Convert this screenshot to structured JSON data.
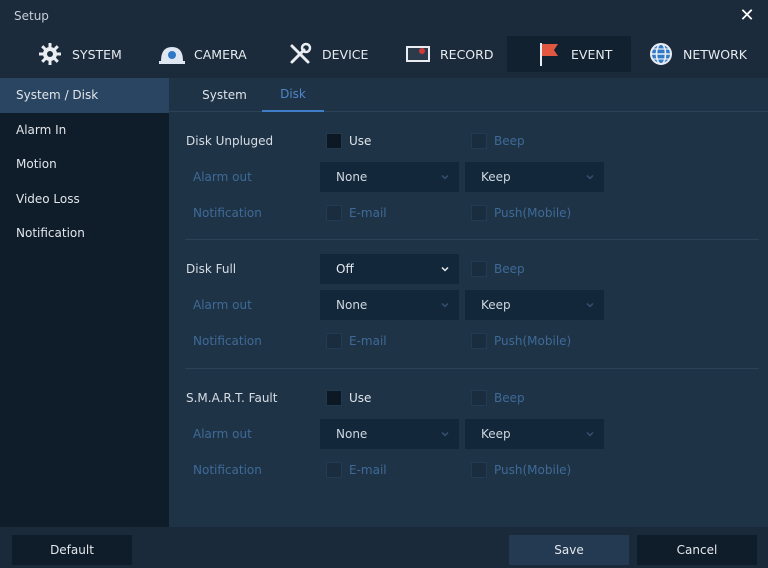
{
  "window": {
    "title": "Setup",
    "close_glyph": "✕"
  },
  "top_tabs": [
    {
      "label": "SYSTEM",
      "icon": "gear-icon"
    },
    {
      "label": "CAMERA",
      "icon": "camera-icon"
    },
    {
      "label": "DEVICE",
      "icon": "tools-icon"
    },
    {
      "label": "RECORD",
      "icon": "record-icon"
    },
    {
      "label": "EVENT",
      "icon": "flag-icon",
      "active": true
    },
    {
      "label": "NETWORK",
      "icon": "globe-icon"
    }
  ],
  "sidebar": {
    "items": [
      {
        "label": "System / Disk",
        "active": true
      },
      {
        "label": "Alarm In"
      },
      {
        "label": "Motion"
      },
      {
        "label": "Video Loss"
      },
      {
        "label": "Notification"
      }
    ]
  },
  "subtabs": [
    {
      "label": "System"
    },
    {
      "label": "Disk",
      "active": true
    }
  ],
  "sections": [
    {
      "title": "Disk Unpluged",
      "use_label": "Use",
      "beep_label": "Beep",
      "alarm_out_label": "Alarm out",
      "alarm_out_value": "None",
      "keep_value": "Keep",
      "notification_label": "Notification",
      "email_label": "E-mail",
      "push_label": "Push(Mobile)"
    },
    {
      "title": "Disk Full",
      "select_value": "Off",
      "beep_label": "Beep",
      "alarm_out_label": "Alarm out",
      "alarm_out_value": "None",
      "keep_value": "Keep",
      "notification_label": "Notification",
      "email_label": "E-mail",
      "push_label": "Push(Mobile)"
    },
    {
      "title": "S.M.A.R.T. Fault",
      "use_label": "Use",
      "beep_label": "Beep",
      "alarm_out_label": "Alarm out",
      "alarm_out_value": "None",
      "keep_value": "Keep",
      "notification_label": "Notification",
      "email_label": "E-mail",
      "push_label": "Push(Mobile)"
    }
  ],
  "footer": {
    "default_label": "Default",
    "save_label": "Save",
    "cancel_label": "Cancel"
  },
  "colors": {
    "accent": "#3f7ec7",
    "dim_text": "#3e6a97"
  }
}
